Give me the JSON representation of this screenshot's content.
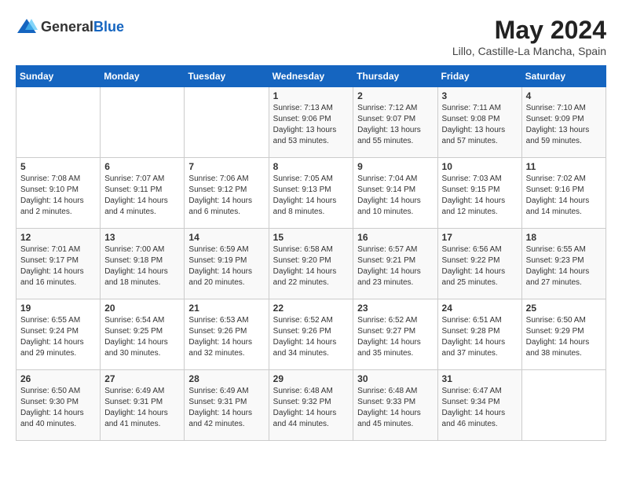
{
  "header": {
    "logo_general": "General",
    "logo_blue": "Blue",
    "month_year": "May 2024",
    "location": "Lillo, Castille-La Mancha, Spain"
  },
  "days_of_week": [
    "Sunday",
    "Monday",
    "Tuesday",
    "Wednesday",
    "Thursday",
    "Friday",
    "Saturday"
  ],
  "weeks": [
    [
      {
        "day": "",
        "info": ""
      },
      {
        "day": "",
        "info": ""
      },
      {
        "day": "",
        "info": ""
      },
      {
        "day": "1",
        "info": "Sunrise: 7:13 AM\nSunset: 9:06 PM\nDaylight: 13 hours and 53 minutes."
      },
      {
        "day": "2",
        "info": "Sunrise: 7:12 AM\nSunset: 9:07 PM\nDaylight: 13 hours and 55 minutes."
      },
      {
        "day": "3",
        "info": "Sunrise: 7:11 AM\nSunset: 9:08 PM\nDaylight: 13 hours and 57 minutes."
      },
      {
        "day": "4",
        "info": "Sunrise: 7:10 AM\nSunset: 9:09 PM\nDaylight: 13 hours and 59 minutes."
      }
    ],
    [
      {
        "day": "5",
        "info": "Sunrise: 7:08 AM\nSunset: 9:10 PM\nDaylight: 14 hours and 2 minutes."
      },
      {
        "day": "6",
        "info": "Sunrise: 7:07 AM\nSunset: 9:11 PM\nDaylight: 14 hours and 4 minutes."
      },
      {
        "day": "7",
        "info": "Sunrise: 7:06 AM\nSunset: 9:12 PM\nDaylight: 14 hours and 6 minutes."
      },
      {
        "day": "8",
        "info": "Sunrise: 7:05 AM\nSunset: 9:13 PM\nDaylight: 14 hours and 8 minutes."
      },
      {
        "day": "9",
        "info": "Sunrise: 7:04 AM\nSunset: 9:14 PM\nDaylight: 14 hours and 10 minutes."
      },
      {
        "day": "10",
        "info": "Sunrise: 7:03 AM\nSunset: 9:15 PM\nDaylight: 14 hours and 12 minutes."
      },
      {
        "day": "11",
        "info": "Sunrise: 7:02 AM\nSunset: 9:16 PM\nDaylight: 14 hours and 14 minutes."
      }
    ],
    [
      {
        "day": "12",
        "info": "Sunrise: 7:01 AM\nSunset: 9:17 PM\nDaylight: 14 hours and 16 minutes."
      },
      {
        "day": "13",
        "info": "Sunrise: 7:00 AM\nSunset: 9:18 PM\nDaylight: 14 hours and 18 minutes."
      },
      {
        "day": "14",
        "info": "Sunrise: 6:59 AM\nSunset: 9:19 PM\nDaylight: 14 hours and 20 minutes."
      },
      {
        "day": "15",
        "info": "Sunrise: 6:58 AM\nSunset: 9:20 PM\nDaylight: 14 hours and 22 minutes."
      },
      {
        "day": "16",
        "info": "Sunrise: 6:57 AM\nSunset: 9:21 PM\nDaylight: 14 hours and 23 minutes."
      },
      {
        "day": "17",
        "info": "Sunrise: 6:56 AM\nSunset: 9:22 PM\nDaylight: 14 hours and 25 minutes."
      },
      {
        "day": "18",
        "info": "Sunrise: 6:55 AM\nSunset: 9:23 PM\nDaylight: 14 hours and 27 minutes."
      }
    ],
    [
      {
        "day": "19",
        "info": "Sunrise: 6:55 AM\nSunset: 9:24 PM\nDaylight: 14 hours and 29 minutes."
      },
      {
        "day": "20",
        "info": "Sunrise: 6:54 AM\nSunset: 9:25 PM\nDaylight: 14 hours and 30 minutes."
      },
      {
        "day": "21",
        "info": "Sunrise: 6:53 AM\nSunset: 9:26 PM\nDaylight: 14 hours and 32 minutes."
      },
      {
        "day": "22",
        "info": "Sunrise: 6:52 AM\nSunset: 9:26 PM\nDaylight: 14 hours and 34 minutes."
      },
      {
        "day": "23",
        "info": "Sunrise: 6:52 AM\nSunset: 9:27 PM\nDaylight: 14 hours and 35 minutes."
      },
      {
        "day": "24",
        "info": "Sunrise: 6:51 AM\nSunset: 9:28 PM\nDaylight: 14 hours and 37 minutes."
      },
      {
        "day": "25",
        "info": "Sunrise: 6:50 AM\nSunset: 9:29 PM\nDaylight: 14 hours and 38 minutes."
      }
    ],
    [
      {
        "day": "26",
        "info": "Sunrise: 6:50 AM\nSunset: 9:30 PM\nDaylight: 14 hours and 40 minutes."
      },
      {
        "day": "27",
        "info": "Sunrise: 6:49 AM\nSunset: 9:31 PM\nDaylight: 14 hours and 41 minutes."
      },
      {
        "day": "28",
        "info": "Sunrise: 6:49 AM\nSunset: 9:31 PM\nDaylight: 14 hours and 42 minutes."
      },
      {
        "day": "29",
        "info": "Sunrise: 6:48 AM\nSunset: 9:32 PM\nDaylight: 14 hours and 44 minutes."
      },
      {
        "day": "30",
        "info": "Sunrise: 6:48 AM\nSunset: 9:33 PM\nDaylight: 14 hours and 45 minutes."
      },
      {
        "day": "31",
        "info": "Sunrise: 6:47 AM\nSunset: 9:34 PM\nDaylight: 14 hours and 46 minutes."
      },
      {
        "day": "",
        "info": ""
      }
    ]
  ]
}
